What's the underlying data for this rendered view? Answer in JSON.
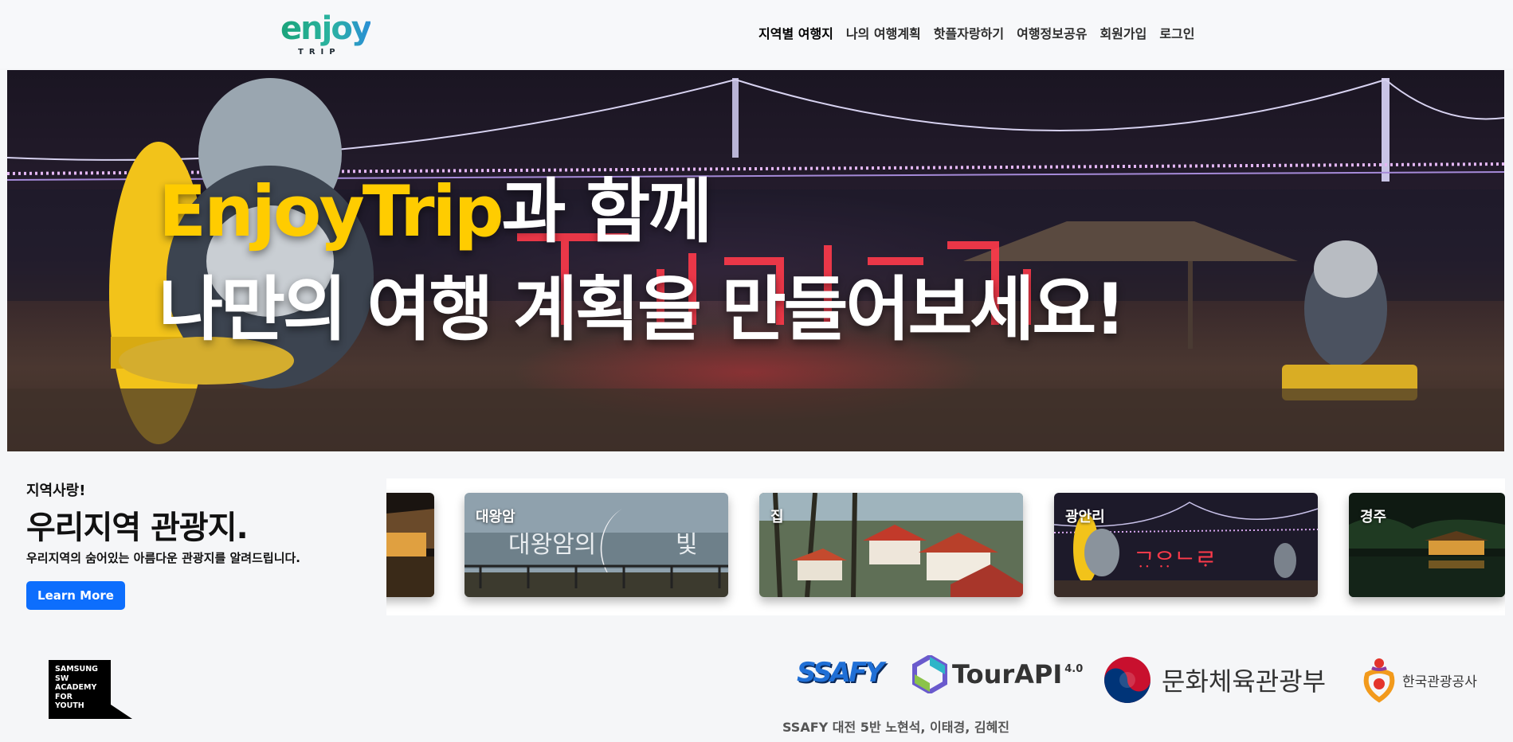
{
  "header": {
    "logo_text": "enjoy",
    "logo_subtext": "TRIP",
    "nav": [
      {
        "label": "지역별 여행지"
      },
      {
        "label": "나의 여행계획"
      },
      {
        "label": "핫플자랑하기"
      },
      {
        "label": "여행정보공유"
      },
      {
        "label": "회원가입"
      },
      {
        "label": "로그인"
      }
    ]
  },
  "hero": {
    "brand": "EnjoyTrip",
    "line1_rest": "과 함께",
    "line2": "나만의 여행 계획을 만들어보세요!",
    "brand_color": "#ffcc00"
  },
  "promo": {
    "kicker": "지역사랑!",
    "title": "우리지역 관광지.",
    "description": "우리지역의 숨어있는 아름다운 관광지를 알려드립니다.",
    "button_label": "Learn More",
    "button_color": "#0d6efd"
  },
  "carousel": {
    "cards": [
      {
        "label": ""
      },
      {
        "label": "대왕암"
      },
      {
        "label": "집"
      },
      {
        "label": "광안리"
      },
      {
        "label": "경주"
      }
    ]
  },
  "footer": {
    "academy_lines": [
      "SAMSUNG",
      "SW",
      "ACADEMY",
      "FOR",
      "YOUTH"
    ],
    "partners": {
      "ssafy": "SSAFY",
      "tourapi": "TourAPI",
      "tourapi_version": "4.0",
      "mcst": "문화체육관광부",
      "kto": "한국관광공사"
    },
    "credit": "SSAFY 대전 5반 노현석, 이태경, 김혜진"
  }
}
